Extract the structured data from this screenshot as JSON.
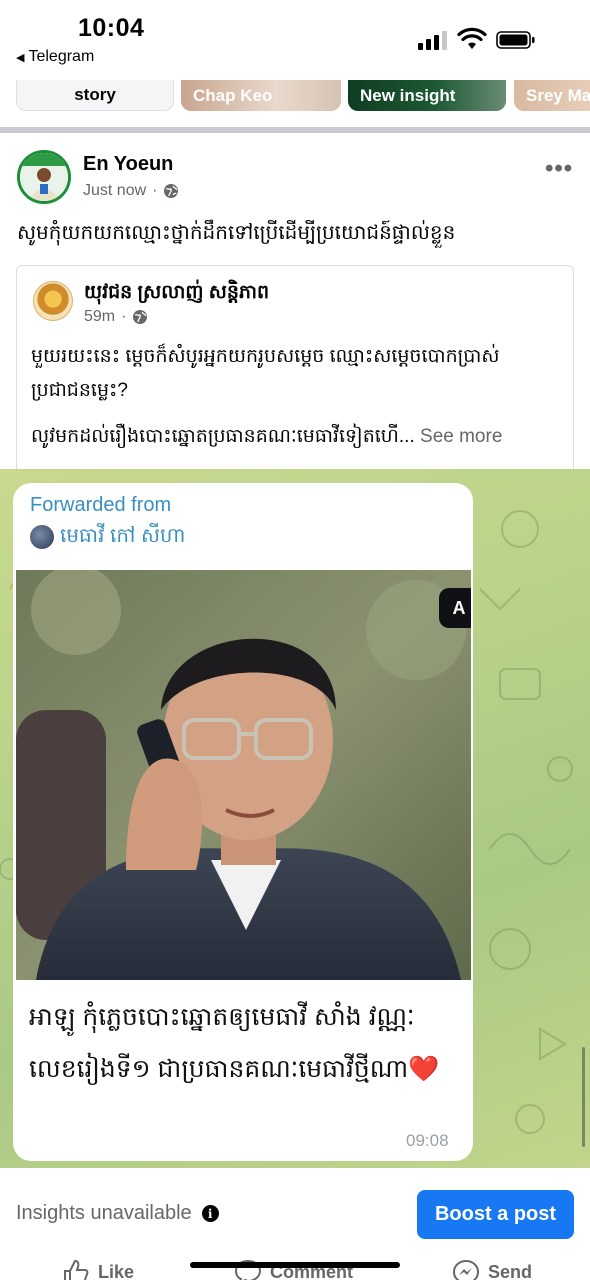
{
  "status_bar": {
    "time": "10:04",
    "back_app": "Telegram",
    "back_icon": "back-arrow-icon",
    "signal_icon": "cellular-signal-icon",
    "wifi_icon": "wifi-icon",
    "battery_icon": "battery-icon"
  },
  "stories": [
    {
      "label": "story"
    },
    {
      "label": "Chap Keo"
    },
    {
      "label": "New insight"
    },
    {
      "label": "Srey Ma"
    }
  ],
  "post": {
    "author": "En Yoeun",
    "time": "Just now",
    "privacy_icon": "globe-icon",
    "more_icon": "more-options-icon",
    "caption": "សូមកុំយកយកឈ្មោះថ្នាក់ដឹកទៅប្រើដើម្បីប្រយោជន៍ផ្ទាល់ខ្លួន"
  },
  "shared_post": {
    "author": "យុវជន ស្រលាញ់ សន្តិភាព",
    "time": "59m",
    "body_line1": "មួយរយះនេះ ម្តេចក៏សំបូរអ្នកយករូបសម្តេច ឈ្មោះសម្តេចបោកប្រាស់ប្រជាជនម្លេះ?",
    "body_line2": "លូវមកដល់រឿងបោះឆ្នោតប្រធានគណៈមេធាវីទៀតហើ...",
    "see_more": "See more"
  },
  "telegram": {
    "forwarded_label": "Forwarded from",
    "forwarded_name": "មេធាវី កៅ សីហា",
    "message": "អាឡូ កុំភ្លេចបោះឆ្នោតឲ្យមេធាវី សាំង វណ្ណៈ លេខរៀងទី១ ជាប្រធានគណៈមេធាវីថ្មីណា",
    "heart": "❤️",
    "time": "09:08",
    "badge_text": "A"
  },
  "footer": {
    "insights_text": "Insights unavailable",
    "info_icon": "info-icon",
    "boost_label": "Boost a post",
    "actions": [
      {
        "label": "Like",
        "icon": "thumbs-up-icon"
      },
      {
        "label": "Comment",
        "icon": "comment-icon"
      },
      {
        "label": "Send",
        "icon": "messenger-icon"
      }
    ]
  },
  "colors": {
    "accent_blue": "#1877f2",
    "telegram_link": "#3a8fc1",
    "avatar_ring": "#1d8f3a",
    "telegram_bg": "#b9d28a"
  }
}
